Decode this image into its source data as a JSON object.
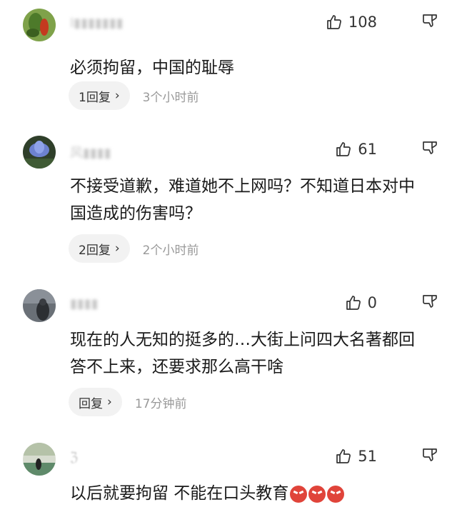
{
  "comments": [
    {
      "username": "I▮▮▮▮▮▮▮",
      "likes": "108",
      "content": "必须拘留，中国的耻辱",
      "reply_label": "1回复",
      "time": "3个小时前",
      "avatar_color": "#6a8f3a"
    },
    {
      "username": "风▮▮▮▮",
      "likes": "61",
      "content": "不接受道歉，难道她不上网吗？不知道日本对中国造成的伤害吗？",
      "reply_label": "2回复",
      "time": "2个小时前",
      "avatar_color": "#5a6fb0"
    },
    {
      "username": "▮▮▮▮",
      "likes": "0",
      "content": "现在的人无知的挺多的…大街上问四大名著都回答不上来，还要求那么高干啥",
      "reply_label": "回复",
      "time": "17分钟前",
      "avatar_color": "#4a4f56"
    },
    {
      "username": "ℨ",
      "likes": "51",
      "content": "以后就要拘留 不能在口头教育",
      "avatar_color": "#5f8a6a"
    }
  ]
}
